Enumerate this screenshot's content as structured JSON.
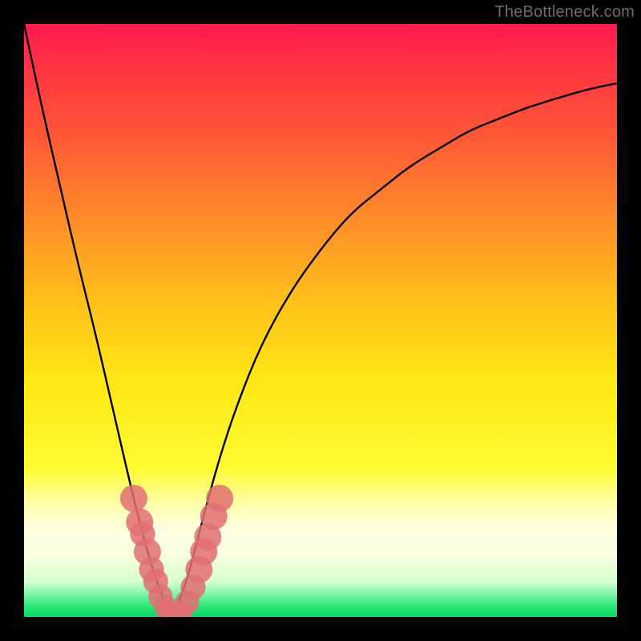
{
  "watermark": "TheBottleneck.com",
  "chart_data": {
    "type": "line",
    "title": "",
    "xlabel": "",
    "ylabel": "",
    "xlim": [
      0,
      100
    ],
    "ylim": [
      0,
      100
    ],
    "grid": false,
    "legend": false,
    "background_gradient": {
      "stops": [
        {
          "pos": 0.0,
          "color": "#ff1a4f"
        },
        {
          "pos": 0.25,
          "color": "#ff5736"
        },
        {
          "pos": 0.5,
          "color": "#ffbf1b"
        },
        {
          "pos": 0.72,
          "color": "#fffb33"
        },
        {
          "pos": 0.88,
          "color": "#ffffe2"
        },
        {
          "pos": 0.96,
          "color": "#7cf7a8"
        },
        {
          "pos": 1.0,
          "color": "#08d860"
        }
      ]
    },
    "series": [
      {
        "name": "bottleneck-curve",
        "x": [
          0,
          3,
          6,
          9,
          12,
          15,
          18,
          20,
          22,
          24,
          25,
          26,
          28,
          30,
          33,
          36,
          40,
          45,
          50,
          55,
          60,
          65,
          70,
          75,
          80,
          85,
          90,
          95,
          100
        ],
        "y": [
          100,
          86,
          73,
          60,
          48,
          35,
          22,
          14,
          7,
          2,
          0,
          2,
          8,
          16,
          27,
          36,
          46,
          55,
          62,
          68,
          72,
          76,
          79,
          82,
          84,
          86,
          87.5,
          89,
          90
        ]
      }
    ],
    "markers": {
      "name": "highlight-points",
      "color": "#e06f73",
      "points": [
        {
          "x": 18.5,
          "y": 20,
          "r": 1.8
        },
        {
          "x": 19.5,
          "y": 16,
          "r": 1.8
        },
        {
          "x": 20.0,
          "y": 14,
          "r": 1.6
        },
        {
          "x": 20.8,
          "y": 11,
          "r": 1.8
        },
        {
          "x": 21.5,
          "y": 8,
          "r": 1.6
        },
        {
          "x": 22.2,
          "y": 6,
          "r": 1.6
        },
        {
          "x": 23.0,
          "y": 3.5,
          "r": 1.5
        },
        {
          "x": 23.8,
          "y": 1.8,
          "r": 1.4
        },
        {
          "x": 24.5,
          "y": 0.8,
          "r": 1.4
        },
        {
          "x": 25.0,
          "y": 0.3,
          "r": 1.4
        },
        {
          "x": 25.8,
          "y": 0.3,
          "r": 1.4
        },
        {
          "x": 26.5,
          "y": 0.8,
          "r": 1.4
        },
        {
          "x": 27.5,
          "y": 2.5,
          "r": 1.5
        },
        {
          "x": 28.5,
          "y": 5.0,
          "r": 1.6
        },
        {
          "x": 29.5,
          "y": 8.0,
          "r": 1.8
        },
        {
          "x": 30.3,
          "y": 11.0,
          "r": 1.8
        },
        {
          "x": 31.0,
          "y": 13.5,
          "r": 1.8
        },
        {
          "x": 32.0,
          "y": 17.0,
          "r": 1.8
        },
        {
          "x": 33.0,
          "y": 20.0,
          "r": 1.8
        }
      ]
    }
  }
}
